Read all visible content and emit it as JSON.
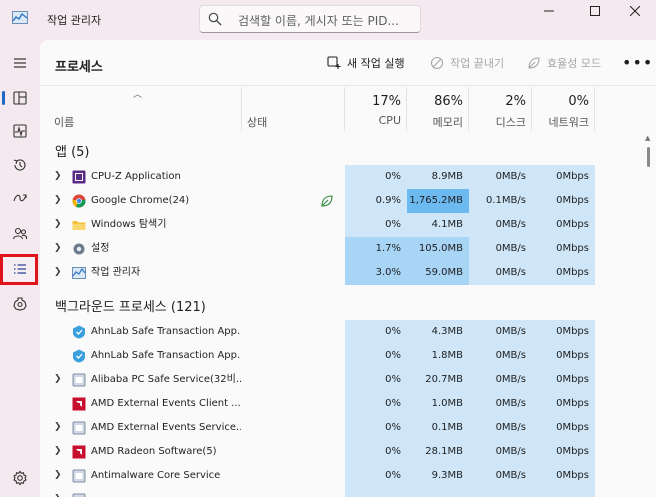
{
  "window": {
    "title": "작업 관리자",
    "search_placeholder": "검색할 이름, 게시자 또는 PID...",
    "controls": [
      "minimize",
      "maximize",
      "close"
    ]
  },
  "sidebar": {
    "items": [
      {
        "icon": "hamburger-menu-icon"
      },
      {
        "icon": "processes-icon",
        "active": true
      },
      {
        "icon": "performance-icon"
      },
      {
        "icon": "app-history-icon"
      },
      {
        "icon": "startup-apps-icon"
      },
      {
        "icon": "users-icon"
      },
      {
        "icon": "details-icon",
        "highlighted": true
      },
      {
        "icon": "services-icon"
      },
      {
        "icon": "settings-icon"
      }
    ],
    "highlight_color": "#e0131b"
  },
  "commandbar": {
    "page_title": "프로세스",
    "new_task": "새 작업 실행",
    "end_task": "작업 끝내기",
    "efficiency_mode": "효율성 모드",
    "more": "•••"
  },
  "columns": {
    "name": "이름",
    "status": "상태",
    "cpu": {
      "pct": "17%",
      "label": "CPU"
    },
    "memory": {
      "pct": "86%",
      "label": "메모리"
    },
    "disk": {
      "pct": "2%",
      "label": "디스크"
    },
    "network": {
      "pct": "0%",
      "label": "네트워크"
    }
  },
  "sections": {
    "apps": "앱 (5)",
    "background": "백그라운드 프로세스 (121)"
  },
  "apps": [
    {
      "name": "CPU-Z Application",
      "icon": "cpuz-icon",
      "cpu": "0%",
      "mem": "8.9MB",
      "disk": "0MB/s",
      "net": "0Mbps",
      "expandable": true
    },
    {
      "name": "Google Chrome(24)",
      "icon": "chrome-icon",
      "cpu": "0.9%",
      "mem": "1,765.2MB",
      "disk": "0.1MB/s",
      "net": "0Mbps",
      "expandable": true,
      "efficiency": true
    },
    {
      "name": "Windows 탐색기",
      "icon": "folder-icon",
      "cpu": "0%",
      "mem": "4.1MB",
      "disk": "0MB/s",
      "net": "0Mbps",
      "expandable": true
    },
    {
      "name": "설정",
      "icon": "settings-app-icon",
      "cpu": "1.7%",
      "mem": "105.0MB",
      "disk": "0MB/s",
      "net": "0Mbps",
      "expandable": true
    },
    {
      "name": "작업 관리자",
      "icon": "task-manager-icon",
      "cpu": "3.0%",
      "mem": "59.0MB",
      "disk": "0MB/s",
      "net": "0Mbps",
      "expandable": true
    }
  ],
  "background": [
    {
      "name": "AhnLab Safe Transaction App...",
      "icon": "ahnlab-icon",
      "cpu": "0%",
      "mem": "4.3MB",
      "disk": "0MB/s",
      "net": "0Mbps",
      "expandable": false
    },
    {
      "name": "AhnLab Safe Transaction App...",
      "icon": "ahnlab-icon",
      "cpu": "0%",
      "mem": "1.8MB",
      "disk": "0MB/s",
      "net": "0Mbps",
      "expandable": false
    },
    {
      "name": "Alibaba PC Safe Service(32비...",
      "icon": "service-icon",
      "cpu": "0%",
      "mem": "20.7MB",
      "disk": "0MB/s",
      "net": "0Mbps",
      "expandable": true
    },
    {
      "name": "AMD External Events Client ...",
      "icon": "amd-icon",
      "cpu": "0%",
      "mem": "1.0MB",
      "disk": "0MB/s",
      "net": "0Mbps",
      "expandable": false
    },
    {
      "name": "AMD External Events Service...",
      "icon": "service-icon",
      "cpu": "0%",
      "mem": "0.1MB",
      "disk": "0MB/s",
      "net": "0Mbps",
      "expandable": true
    },
    {
      "name": "AMD Radeon Software(5)",
      "icon": "amd-icon",
      "cpu": "0%",
      "mem": "28.1MB",
      "disk": "0MB/s",
      "net": "0Mbps",
      "expandable": true
    },
    {
      "name": "Antimalware Core Service",
      "icon": "service-icon",
      "cpu": "0%",
      "mem": "9.3MB",
      "disk": "0MB/s",
      "net": "0Mbps",
      "expandable": true
    },
    {
      "name": "",
      "icon": "service-icon",
      "cpu": "",
      "mem": "",
      "disk": "",
      "net": "",
      "expandable": true
    }
  ],
  "colors": {
    "heat_light": "#cfe6f8",
    "heat_mid": "#a8d4f5",
    "heat_high": "#6cbaf0",
    "rail_active": "#1e66c8"
  }
}
